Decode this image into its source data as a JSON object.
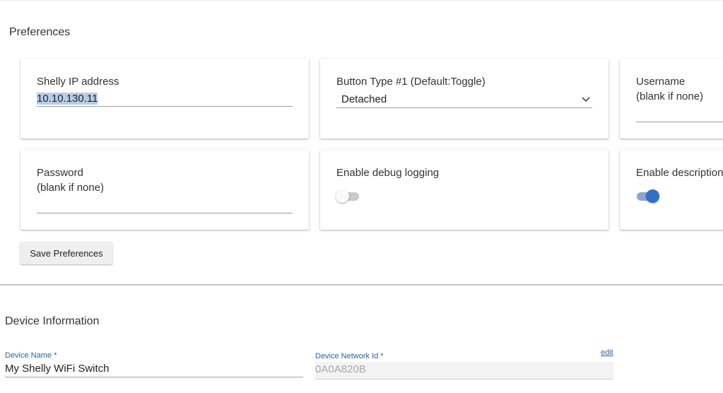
{
  "preferences": {
    "title": "Preferences",
    "shelly_ip": {
      "label": "Shelly IP address",
      "value": "10.10.130.11"
    },
    "button_type": {
      "label": "Button Type #1 (Default:Toggle)",
      "selected": "Detached",
      "icon": "chevron-down-icon"
    },
    "username": {
      "label_line1": "Username",
      "label_line2": "(blank if none)",
      "value": ""
    },
    "password": {
      "label_line1": "Password",
      "label_line2": "(blank if none)",
      "value": ""
    },
    "debug_logging": {
      "label": "Enable debug logging",
      "enabled": false
    },
    "description": {
      "label": "Enable description",
      "enabled": true
    },
    "save_label": "Save Preferences"
  },
  "device_info": {
    "title": "Device Information",
    "device_name": {
      "label": "Device Name *",
      "value": "My Shelly WiFi Switch"
    },
    "network_id": {
      "label": "Device Network Id *",
      "value": "0A0A820B",
      "edit_label": "edit"
    }
  },
  "colors": {
    "accent": "#2f6fcb",
    "link": "#2a5ea8",
    "text_selection": "#b6cdea"
  }
}
